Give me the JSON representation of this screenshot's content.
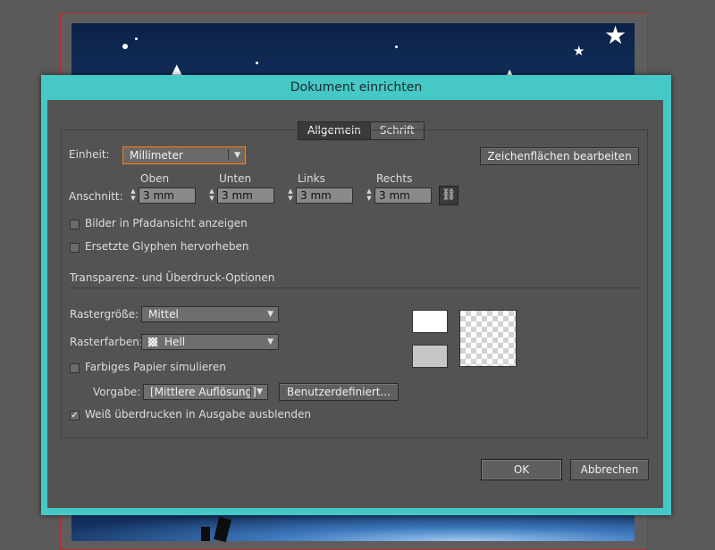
{
  "dialog": {
    "title": "Dokument einrichten",
    "tabs": [
      {
        "label": "Allgemein",
        "active": true
      },
      {
        "label": "Schrift",
        "active": false
      }
    ]
  },
  "document": {
    "unit_label": "Einheit:",
    "unit_value": "Millimeter",
    "edit_artboards_button": "Zeichenflächen bearbeiten",
    "bleed_label": "Anschnitt:",
    "bleed": [
      {
        "label": "Oben",
        "value": "3 mm"
      },
      {
        "label": "Unten",
        "value": "3 mm"
      },
      {
        "label": "Links",
        "value": "3 mm"
      },
      {
        "label": "Rechts",
        "value": "3 mm"
      }
    ],
    "show_images_outline": {
      "label": "Bilder in Pfadansicht anzeigen",
      "checked": false
    },
    "highlight_glyphs": {
      "label": "Ersetzte Glyphen hervorheben",
      "checked": false
    }
  },
  "transparency": {
    "heading": "Transparenz- und Überdruck-Optionen",
    "grid_size_label": "Rastergröße:",
    "grid_size_value": "Mittel",
    "grid_colors_label": "Rasterfarben:",
    "grid_colors_value": "Hell",
    "simulate_paper": {
      "label": "Farbiges Papier simulieren",
      "checked": false
    },
    "preset_label": "Vorgabe:",
    "preset_value": "[Mittlere Auflösung]",
    "custom_button": "Benutzerdefiniert...",
    "discard_white_overprint": {
      "label": "Weiß überdrucken in Ausgabe ausblenden",
      "checked": true
    }
  },
  "footer": {
    "ok_label": "OK",
    "cancel_label": "Abbrechen"
  },
  "icons": {
    "link": "chain-link-icon",
    "dropdown": "chevron-down-icon",
    "spinner": "spinner-arrows-icon",
    "checkbox": "checkmark-icon"
  },
  "colors": {
    "dialog_frame": "#46c8c7",
    "dialog_body": "#535353",
    "focus_ring": "#e08a3a",
    "artboard_sky": "#0b2247"
  }
}
